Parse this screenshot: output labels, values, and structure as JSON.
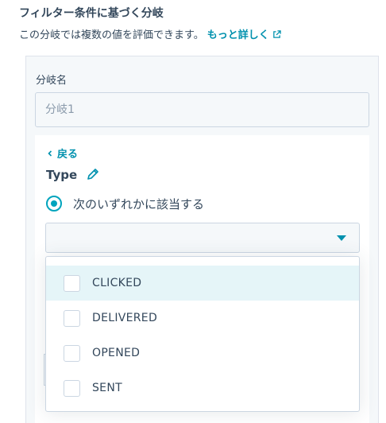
{
  "header": {
    "title": "フィルター条件に基づく分岐",
    "description": "この分岐では複数の値を評価できます。",
    "learn_more": "もっと詳しく"
  },
  "branch_name": {
    "label": "分岐名",
    "placeholder": "分岐1"
  },
  "back_label": "戻る",
  "type_label": "Type",
  "radio_option": "次のいずれかに該当する",
  "dropdown": {
    "options": [
      {
        "label": "CLICKED",
        "checked": false
      },
      {
        "label": "DELIVERED",
        "checked": false
      },
      {
        "label": "OPENED",
        "checked": false
      },
      {
        "label": "SENT",
        "checked": false
      }
    ]
  },
  "colors": {
    "accent": "#0091ae",
    "radio": "#00a4bd",
    "text": "#33475b",
    "highlight": "#e5f5f8"
  },
  "icons": [
    "external-link-icon",
    "chevron-left-icon",
    "pencil-icon",
    "caret-down-icon",
    "checkbox-icon"
  ]
}
